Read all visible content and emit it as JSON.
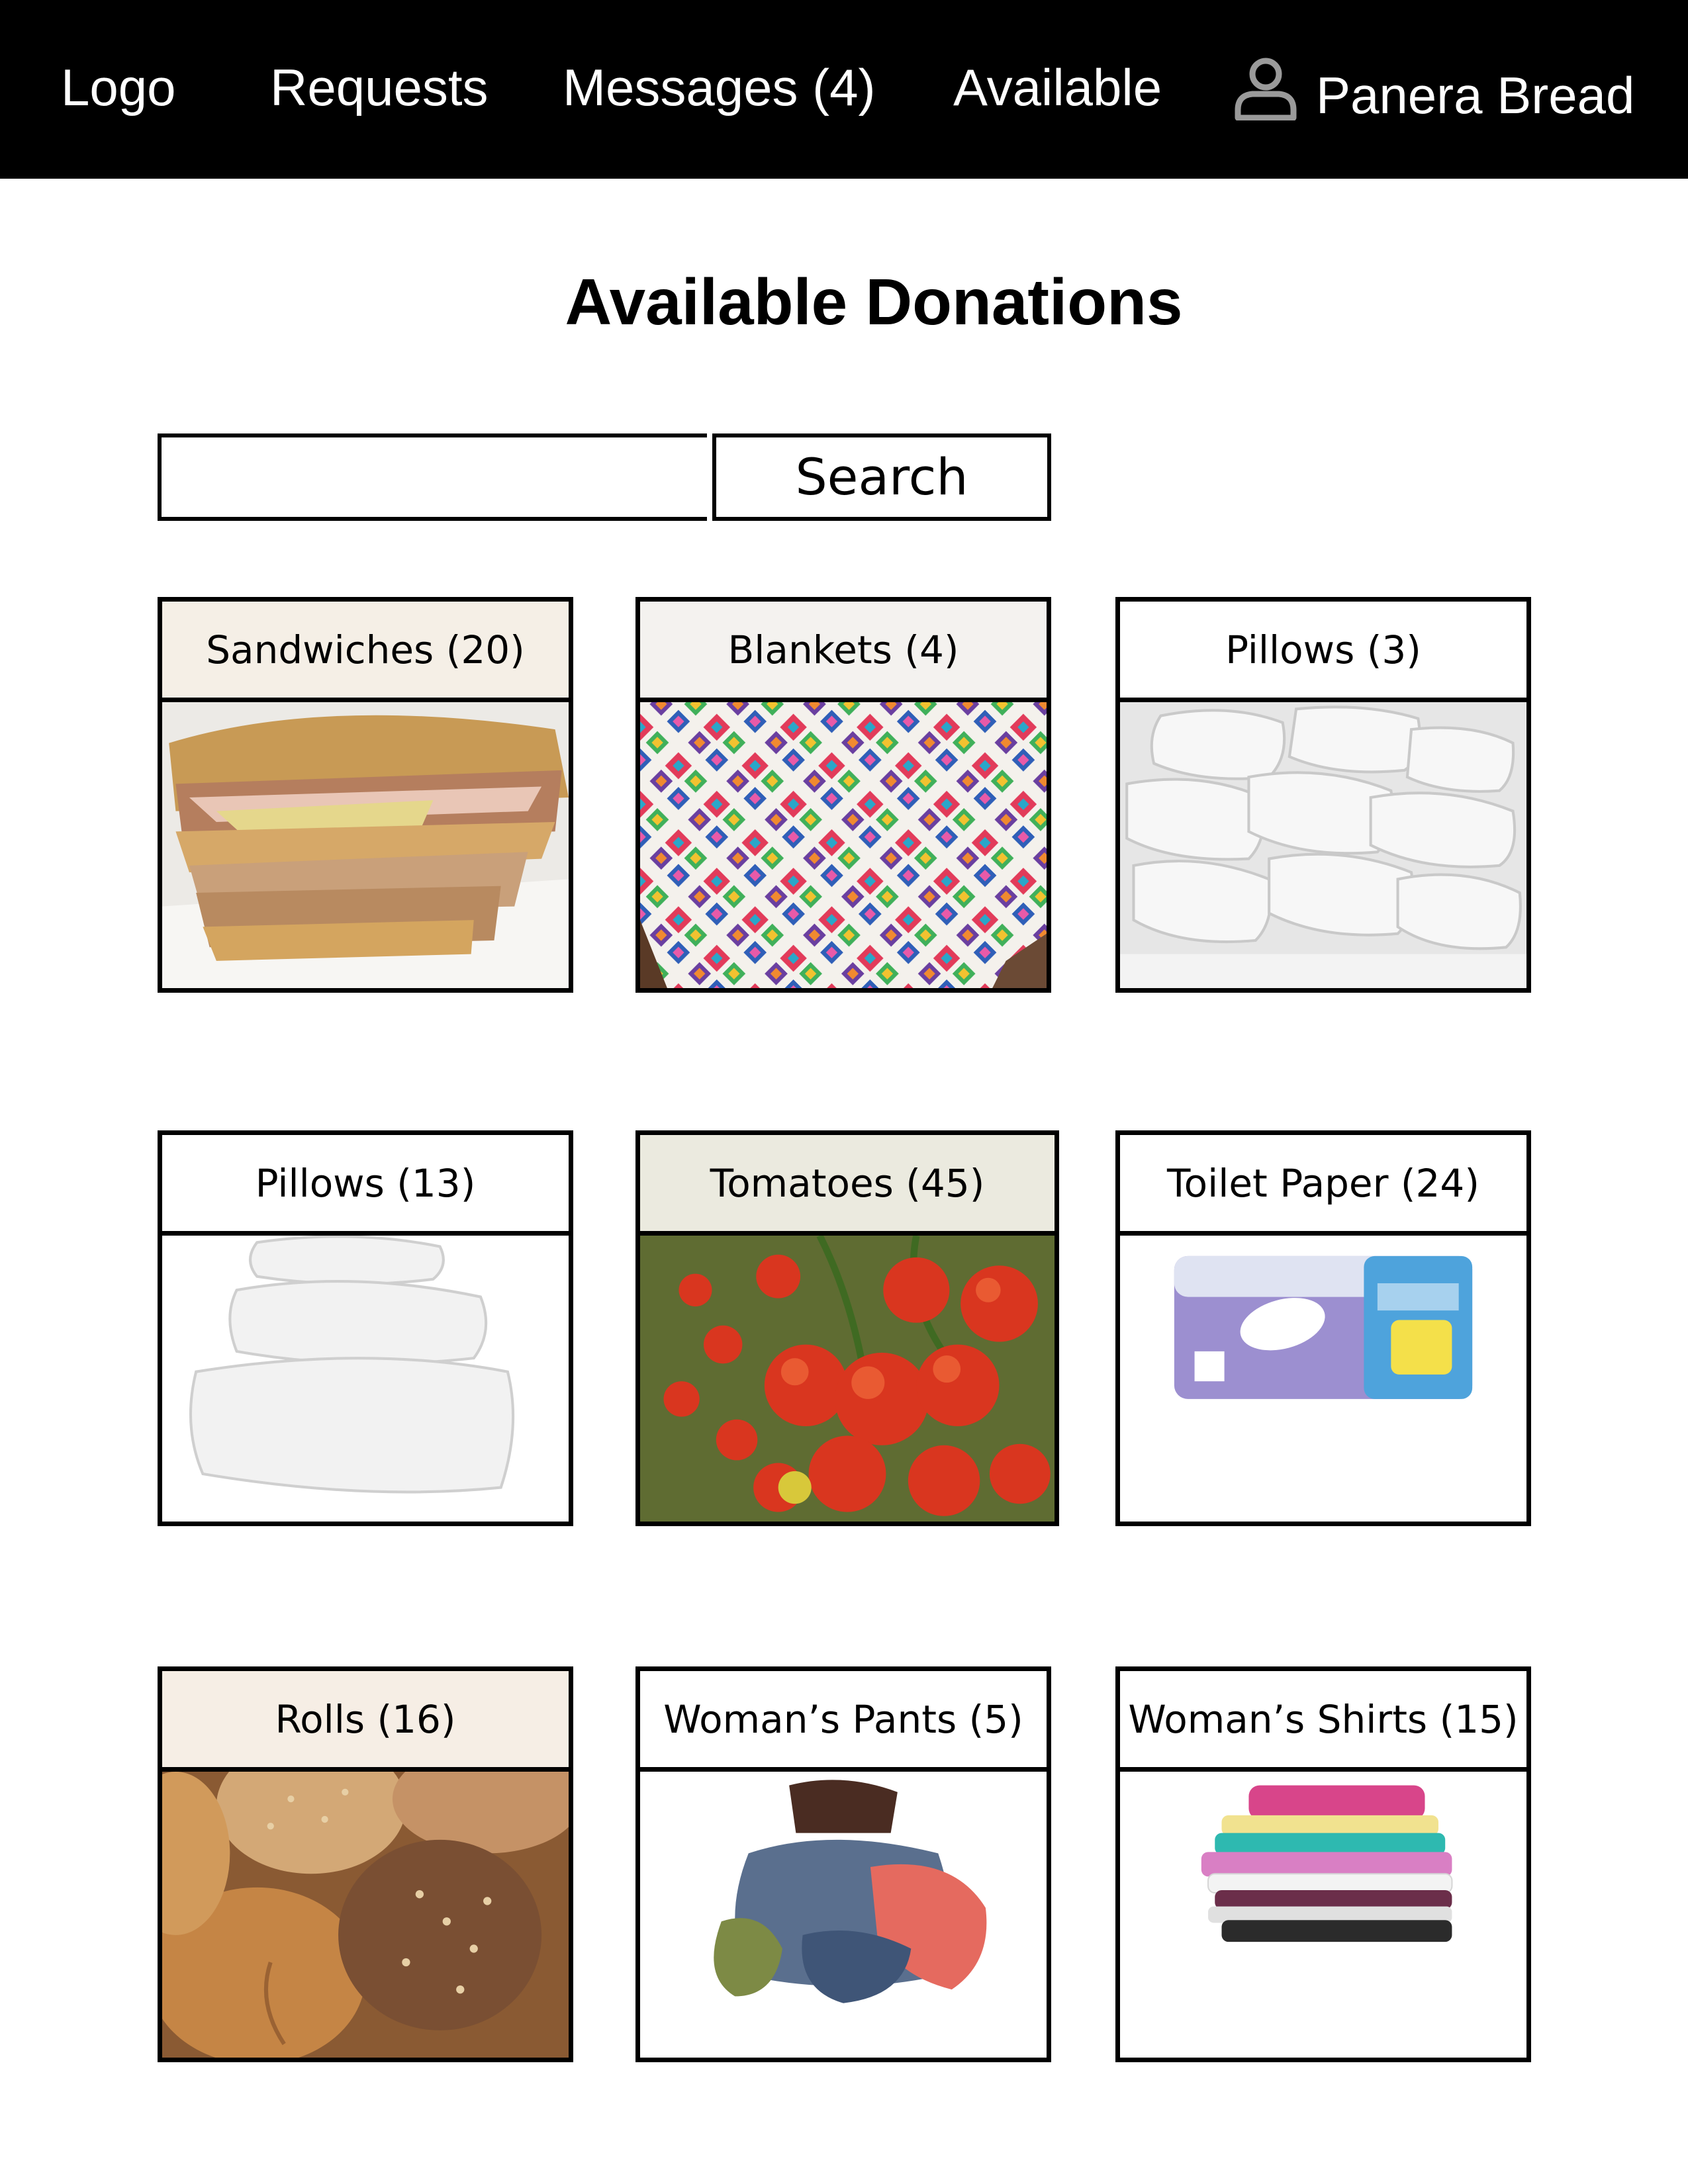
{
  "nav": {
    "logo": "Logo",
    "requests": "Requests",
    "messages": "Messages (4)",
    "available": "Available",
    "account_name": "Panera Bread",
    "account_icon": "user-icon"
  },
  "page": {
    "title": "Available Donations"
  },
  "search": {
    "value": "",
    "button_label": "Search"
  },
  "donations": [
    {
      "label": "Sandwiches (20)",
      "image": "sandwich-image"
    },
    {
      "label": "Blankets (4)",
      "image": "blanket-image"
    },
    {
      "label": "Pillows (3)",
      "image": "pillow-pile-image"
    },
    {
      "label": "Pillows (13)",
      "image": "pillow-stack-image"
    },
    {
      "label": "Tomatoes (45)",
      "image": "tomatoes-image"
    },
    {
      "label": "Toilet Paper (24)",
      "image": "toilet-paper-image"
    },
    {
      "label": "Rolls (16)",
      "image": "bread-rolls-image"
    },
    {
      "label": "Woman’s Pants (5)",
      "image": "pants-pile-image"
    },
    {
      "label": "Woman’s Shirts (15)",
      "image": "folded-shirts-image"
    }
  ]
}
